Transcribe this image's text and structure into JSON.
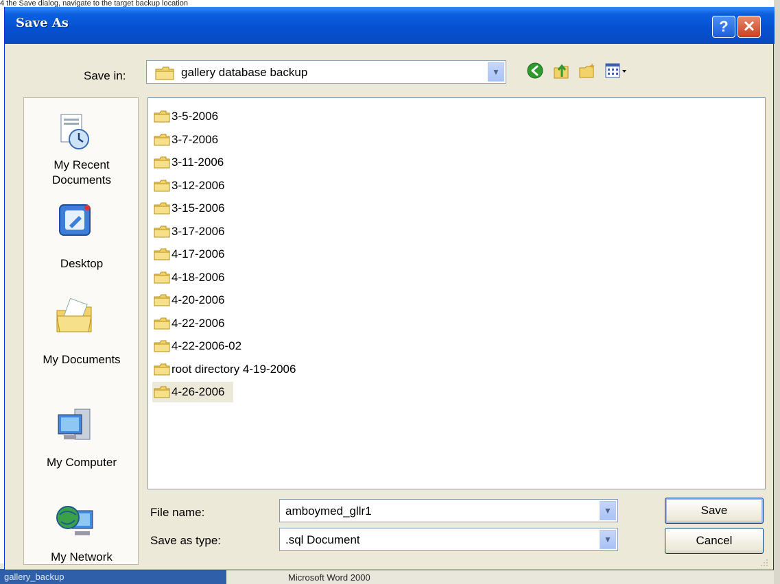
{
  "top_caption": "4 the Save dialog, navigate to the target backup location",
  "background": {
    "task_item": "gallery_backup",
    "word_task": "Microsoft Word 2000"
  },
  "dialog": {
    "title": "Save As",
    "help_glyph": "?",
    "close_glyph": "✕"
  },
  "save_in": {
    "label": "Save in:",
    "value": "gallery database backup"
  },
  "toolbar": {
    "icons": [
      "back-icon",
      "up-one-level-icon",
      "new-folder-icon",
      "views-menu-icon"
    ]
  },
  "places": [
    {
      "label": "My Recent Documents",
      "line1": "My Recent",
      "line2": "Documents",
      "icon": "recent-documents-icon"
    },
    {
      "label": "Desktop",
      "line1": "Desktop",
      "line2": "",
      "icon": "desktop-icon"
    },
    {
      "label": "My Documents",
      "line1": "My Documents",
      "line2": "",
      "icon": "my-documents-icon"
    },
    {
      "label": "My Computer",
      "line1": "My Computer",
      "line2": "",
      "icon": "my-computer-icon"
    },
    {
      "label": "My Network",
      "line1": "My Network",
      "line2": "",
      "icon": "my-network-icon"
    }
  ],
  "files": [
    {
      "name": "3-5-2006",
      "selected": false
    },
    {
      "name": "3-7-2006",
      "selected": false
    },
    {
      "name": "3-11-2006",
      "selected": false
    },
    {
      "name": "3-12-2006",
      "selected": false
    },
    {
      "name": "3-15-2006",
      "selected": false
    },
    {
      "name": "3-17-2006",
      "selected": false
    },
    {
      "name": "4-17-2006",
      "selected": false
    },
    {
      "name": "4-18-2006",
      "selected": false
    },
    {
      "name": "4-20-2006",
      "selected": false
    },
    {
      "name": "4-22-2006",
      "selected": false
    },
    {
      "name": "4-22-2006-02",
      "selected": false
    },
    {
      "name": "root directory 4-19-2006",
      "selected": false
    },
    {
      "name": "4-26-2006",
      "selected": true
    }
  ],
  "file_name": {
    "label": "File name:",
    "value": "amboymed_gllr1"
  },
  "save_as_type": {
    "label": "Save as type:",
    "value": ".sql Document"
  },
  "buttons": {
    "save": "Save",
    "cancel": "Cancel"
  },
  "colors": {
    "titlebar": "#0550d0",
    "dialog_face": "#ece9d8",
    "folder_yellow": "#f2d36b"
  }
}
